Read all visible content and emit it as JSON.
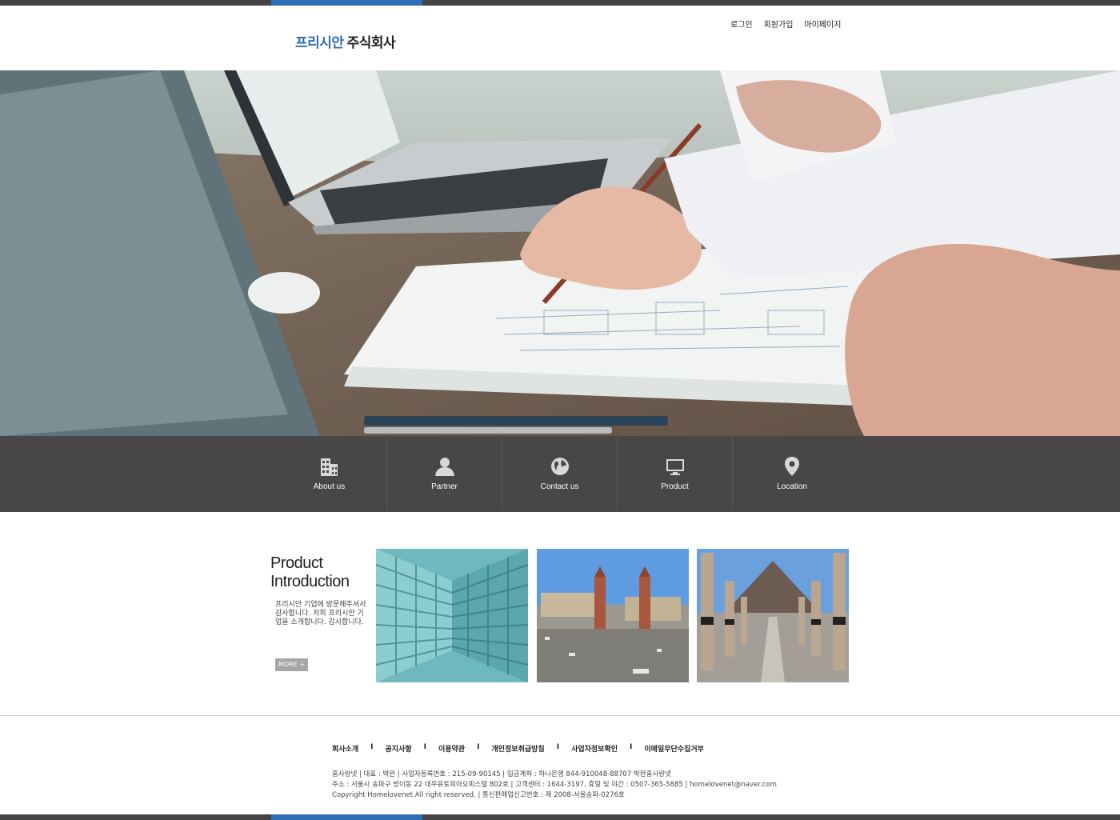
{
  "header": {
    "logo_primary": "프리시안",
    "logo_secondary": "주식회사",
    "util_links": [
      "로그인",
      "회원가입",
      "마이페이지"
    ]
  },
  "hero": {
    "image_icon": "hero-photo"
  },
  "menu": {
    "items": [
      {
        "label": "About us",
        "icon": "building-icon"
      },
      {
        "label": "Partner",
        "icon": "person-icon"
      },
      {
        "label": "Contact us",
        "icon": "globe-icon"
      },
      {
        "label": "Product",
        "icon": "monitor-icon"
      },
      {
        "label": "Location",
        "icon": "location-pin-icon"
      }
    ]
  },
  "intro": {
    "title_line1": "Product",
    "title_line2": "Introduction",
    "text": "프리시안 기업에 방문해주셔서 감사합니다. 저희 프리시안 기업을 소개합니다.  감사합니다.",
    "more_label": "MORE +"
  },
  "footer": {
    "links": [
      "회사소개",
      "공지사항",
      "이용약관",
      "개인정보취급방침",
      "사업자정보확인",
      "이메일무단수집거부"
    ],
    "separator": "I",
    "info_line1": "홈사랑넷  |  대표 : 박완  |  사업자등록번호 : 215-09-90145  |  입금계좌 : 하나은행 844-910048-88707 박완홈사랑넷",
    "info_line2": "주소 : 서울시 송파구 방이동 22 대우유토피아오피스텔 802호  |  고객센터 : 1644-3197, 휴일 및 야간 : 0507-365-5885  |  homelovenet@naver.com",
    "info_line3": "Copyright Homelovenet All right reserved.   |  통신판매업신고번호 : 제 2008-서울송파-0276호"
  },
  "colors": {
    "accent": "#2f6db5",
    "menubar": "#484646",
    "topbar": "#444444"
  }
}
